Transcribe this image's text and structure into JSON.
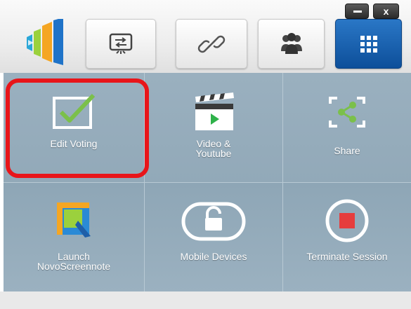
{
  "window": {
    "close_label": "x"
  },
  "toolbar": {
    "buttons": [
      {
        "name": "screen-share-icon"
      },
      {
        "name": "link-icon"
      },
      {
        "name": "people-icon"
      },
      {
        "name": "grid-menu-icon",
        "active": true
      }
    ]
  },
  "tiles": [
    {
      "label": "Edit Voting",
      "icon": "checkbox-icon"
    },
    {
      "label": "Video &\nYoutube",
      "icon": "clapperboard-icon"
    },
    {
      "label": "Share",
      "icon": "share-icon"
    },
    {
      "label": "Launch\nNovoScreennote",
      "icon": "screennote-icon"
    },
    {
      "label": "Mobile Devices",
      "icon": "lock-icon"
    },
    {
      "label": "Terminate Session",
      "icon": "stop-icon"
    }
  ],
  "colors": {
    "accent": "#1662b3",
    "highlight": "#e8151a",
    "panel": "#93aabb",
    "check_green": "#7bc04a",
    "stop_red": "#e63d3d"
  }
}
